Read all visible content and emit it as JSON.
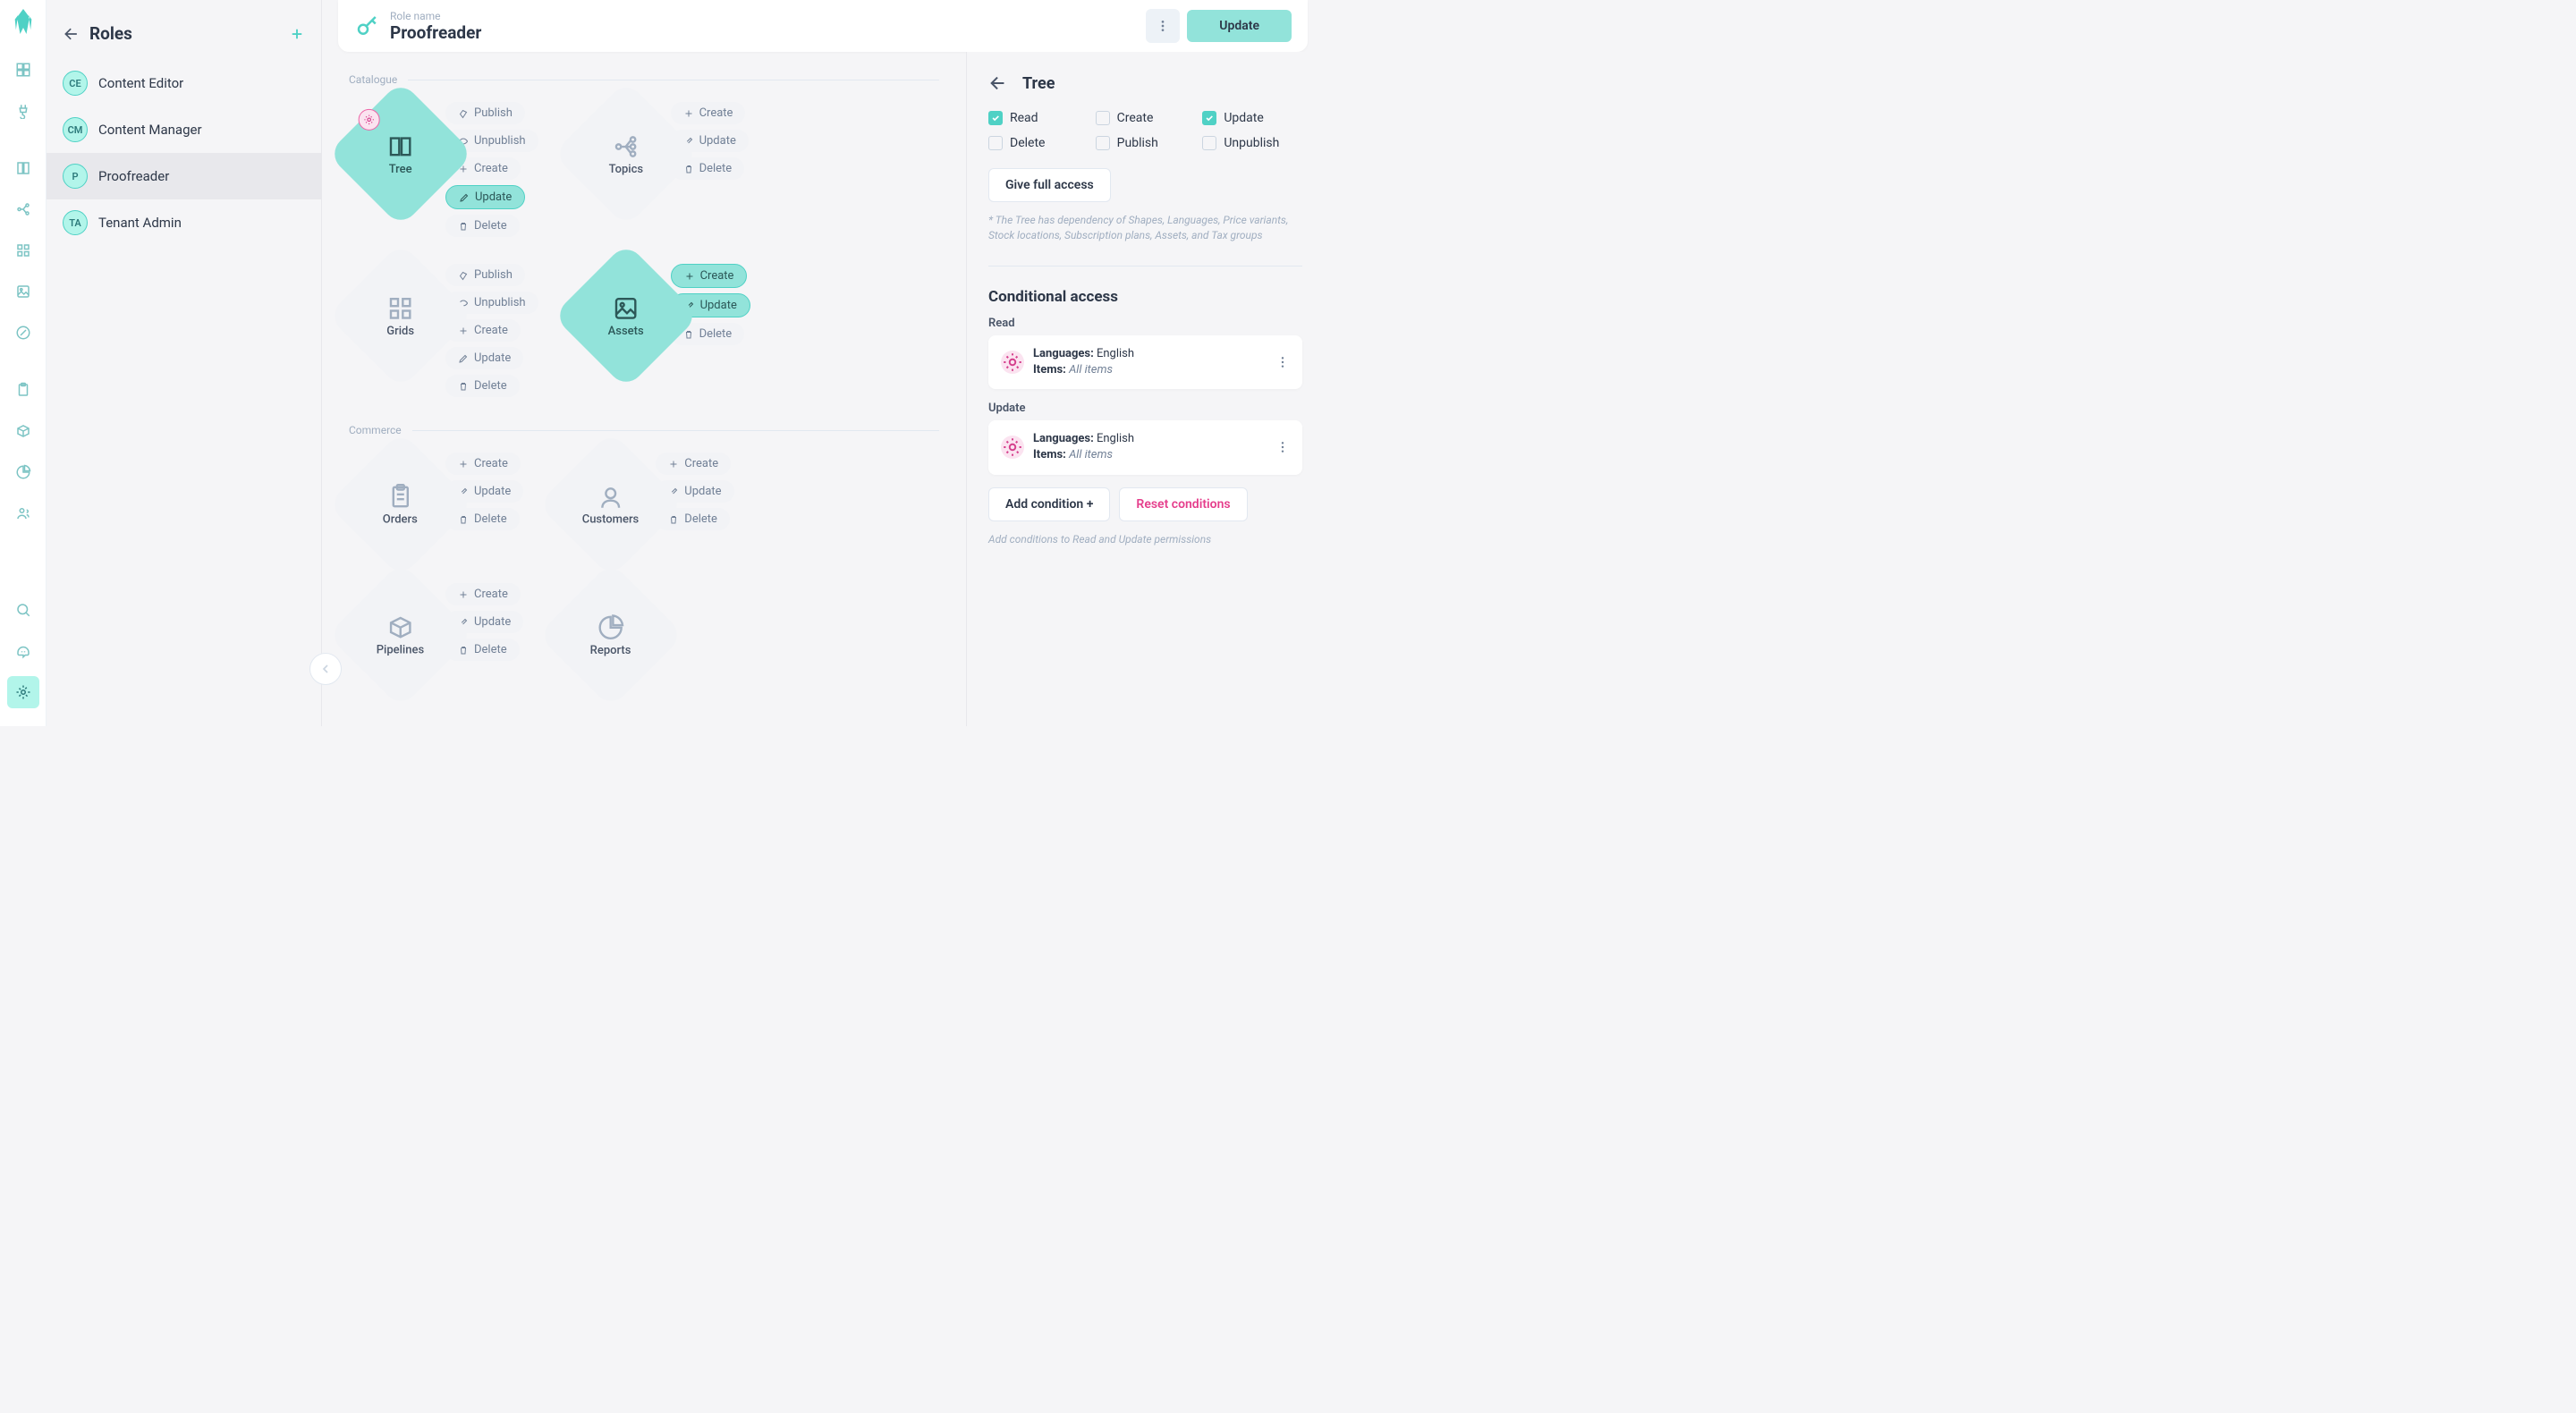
{
  "sidebar_title": "Roles",
  "roles": [
    {
      "abbr": "CE",
      "name": "Content Editor"
    },
    {
      "abbr": "CM",
      "name": "Content Manager"
    },
    {
      "abbr": "P",
      "name": "Proofreader"
    },
    {
      "abbr": "TA",
      "name": "Tenant Admin"
    }
  ],
  "header": {
    "label": "Role name",
    "title": "Proofreader",
    "update": "Update"
  },
  "sections": {
    "catalogue": "Catalogue",
    "commerce": "Commerce"
  },
  "perms": {
    "publish": "Publish",
    "unpublish": "Unpublish",
    "create": "Create",
    "update": "Update",
    "delete": "Delete"
  },
  "diamonds": {
    "tree": "Tree",
    "topics": "Topics",
    "grids": "Grids",
    "assets": "Assets",
    "orders": "Orders",
    "customers": "Customers",
    "pipelines": "Pipelines",
    "reports": "Reports"
  },
  "right": {
    "title": "Tree",
    "checks": {
      "read": "Read",
      "create": "Create",
      "update": "Update",
      "delete": "Delete",
      "publish": "Publish",
      "unpublish": "Unpublish"
    },
    "full_access": "Give full access",
    "dep_hint": "* The Tree has dependency of Shapes, Languages, Price variants, Stock locations, Subscription plans, Assets, and Tax groups",
    "cond_title": "Conditional access",
    "read_label": "Read",
    "update_label": "Update",
    "lang_label": "Languages:",
    "lang_val": "English",
    "items_label": "Items:",
    "items_val": "All items",
    "add_cond": "Add condition +",
    "reset_cond": "Reset conditions",
    "cond_hint": "Add conditions to Read and Update permissions"
  }
}
